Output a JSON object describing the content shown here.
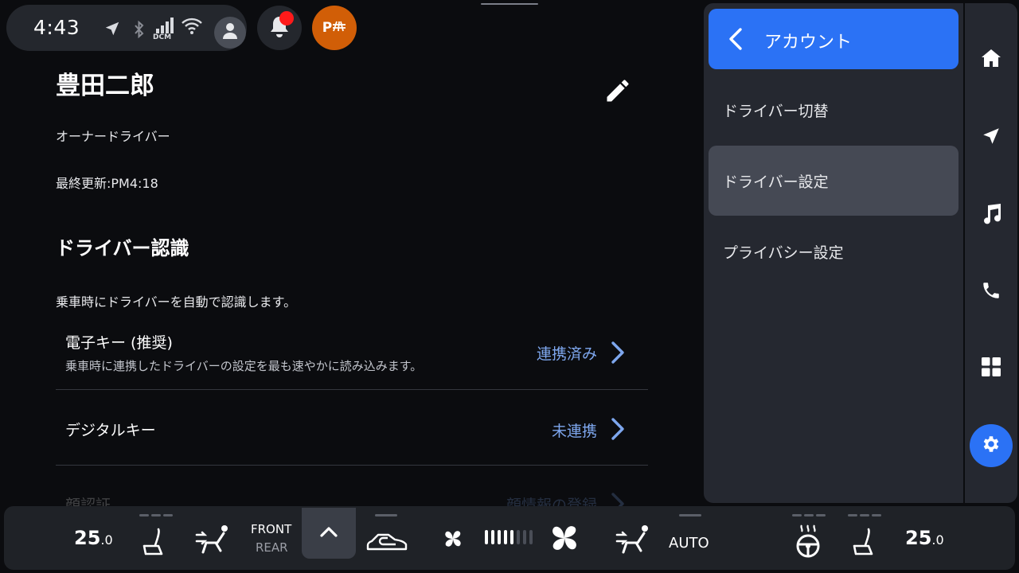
{
  "status": {
    "time": "4:43",
    "dcm_label": "DCM",
    "park_label": "P",
    "notification_dot": true
  },
  "profile": {
    "name": "豊田二郎",
    "role": "オーナードライバー",
    "last_updated": "最終更新:PM4:18"
  },
  "recognition": {
    "title": "ドライバー認識",
    "description": "乗車時にドライバーを自動で認識します。",
    "items": [
      {
        "title": "電子キー (推奨)",
        "subtitle": "乗車時に連携したドライバーの設定を最も速やかに読み込みます。",
        "value": "連携済み"
      },
      {
        "title": "デジタルキー",
        "subtitle": "",
        "value": "未連携"
      },
      {
        "title": "顔認証",
        "subtitle": "",
        "value": "顔情報の登録"
      }
    ]
  },
  "panel": {
    "title": "アカウント",
    "items": [
      {
        "label": "ドライバー切替",
        "selected": false
      },
      {
        "label": "ドライバー設定",
        "selected": true
      },
      {
        "label": "プライバシー設定",
        "selected": false
      }
    ]
  },
  "rail": {
    "items": [
      {
        "icon": "home-icon",
        "active": false
      },
      {
        "icon": "navigation-icon",
        "active": false
      },
      {
        "icon": "music-icon",
        "active": false
      },
      {
        "icon": "phone-icon",
        "active": false
      },
      {
        "icon": "apps-icon",
        "active": false
      },
      {
        "icon": "settings-icon",
        "active": true
      }
    ]
  },
  "climate": {
    "left_temp": "25",
    "left_temp_decimal": ".0",
    "right_temp": "25",
    "right_temp_decimal": ".0",
    "zone_front": "FRONT",
    "zone_rear": "REAR",
    "auto_label": "AUTO",
    "fan_level": 5,
    "fan_max": 8,
    "accent_color": "#2b72f5"
  }
}
